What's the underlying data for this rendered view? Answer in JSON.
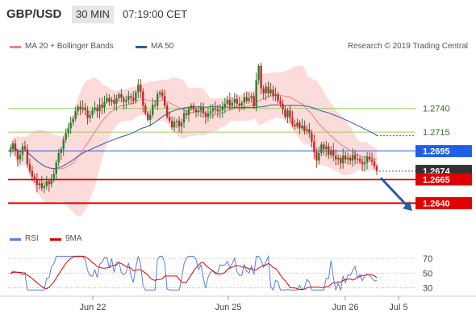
{
  "header": {
    "symbol": "GBP/USD",
    "timeframe": "30 MIN",
    "time": "07:19:00 CET"
  },
  "credit": "Research © 2019 Trading Central",
  "legend": {
    "items": [
      {
        "label": "MA 20 + Bollinger Bands",
        "color": "#f08080"
      },
      {
        "label": "MA 50",
        "color": "#2e5aa8"
      }
    ]
  },
  "rsi_legend": {
    "items": [
      {
        "label": "RSI",
        "color": "#5b7fe0"
      },
      {
        "label": "9MA",
        "color": "#e00000"
      }
    ]
  },
  "colors": {
    "up_candle": "#2e7d32",
    "down_candle": "#c62828",
    "bollinger_fill": "#fbd5d5",
    "ma20": "#f08080",
    "ma50": "#2e5aa8",
    "support": "#e00000",
    "pivot": "#1f5ee8",
    "resistance": "#9ccc65",
    "last_price_tag": "#333333",
    "rsi": "#5b7fe0",
    "rsi_ma": "#e00000"
  },
  "chart_data": [
    {
      "type": "candlestick",
      "title": "GBP/USD",
      "ylim": [
        1.2625,
        1.2795
      ],
      "x_tick_labels": [
        "Jun 22",
        "Jun 25",
        "Jun 26",
        "Jul 5"
      ],
      "y_tick_labels": [
        "1.2740",
        "1.2715",
        "1.2695",
        "1.2674",
        "1.2665",
        "1.2640"
      ],
      "levels": [
        {
          "name": "resistance-2",
          "value": 1.274,
          "label": "1.2740",
          "kind": "resistance"
        },
        {
          "name": "resistance-1",
          "value": 1.2715,
          "label": "1.2715",
          "kind": "resistance"
        },
        {
          "name": "pivot",
          "value": 1.2695,
          "label": "1.2695",
          "kind": "pivot"
        },
        {
          "name": "last-price",
          "value": 1.2674,
          "label": "1.2674",
          "kind": "last"
        },
        {
          "name": "support-1",
          "value": 1.2665,
          "label": "1.2665",
          "kind": "support"
        },
        {
          "name": "support-2",
          "value": 1.264,
          "label": "1.2640",
          "kind": "support"
        }
      ],
      "close": [
        1.2697,
        1.2703,
        1.2695,
        1.2686,
        1.2691,
        1.27,
        1.2697,
        1.2681,
        1.2674,
        1.2668,
        1.2664,
        1.2659,
        1.2661,
        1.2656,
        1.2658,
        1.2663,
        1.266,
        1.2666,
        1.2671,
        1.2683,
        1.2693,
        1.2697,
        1.2707,
        1.2714,
        1.2719,
        1.2725,
        1.2729,
        1.2737,
        1.2742,
        1.2739,
        1.2741,
        1.2738,
        1.273,
        1.2733,
        1.2738,
        1.2741,
        1.2737,
        1.2744,
        1.2741,
        1.2747,
        1.2751,
        1.2747,
        1.2749,
        1.2745,
        1.2751,
        1.2755,
        1.2751,
        1.2747,
        1.2749,
        1.2753,
        1.2751,
        1.2748,
        1.2757,
        1.2765,
        1.2758,
        1.2743,
        1.2735,
        1.2728,
        1.2733,
        1.2744,
        1.2743,
        1.2755,
        1.2757,
        1.2753,
        1.2743,
        1.2731,
        1.2727,
        1.272,
        1.2726,
        1.2727,
        1.2721,
        1.2725,
        1.2735,
        1.2733,
        1.274,
        1.2743,
        1.2739,
        1.2736,
        1.2738,
        1.2741,
        1.2735,
        1.2731,
        1.2735,
        1.2737,
        1.274,
        1.2739,
        1.2737,
        1.2738,
        1.2742,
        1.2745,
        1.2749,
        1.2743,
        1.2746,
        1.275,
        1.2745,
        1.2743,
        1.2746,
        1.2752,
        1.2748,
        1.2751,
        1.2753,
        1.2742,
        1.277,
        1.2785,
        1.2761,
        1.2756,
        1.2763,
        1.2756,
        1.276,
        1.2753,
        1.2755,
        1.2748,
        1.2745,
        1.2739,
        1.2731,
        1.2738,
        1.273,
        1.2723,
        1.2721,
        1.2725,
        1.2719,
        1.2722,
        1.2716,
        1.2718,
        1.2714,
        1.2705,
        1.2694,
        1.2685,
        1.2693,
        1.2702,
        1.2697,
        1.27,
        1.2691,
        1.2696,
        1.269,
        1.2686,
        1.2688,
        1.2682,
        1.269,
        1.2686,
        1.2688,
        1.2685,
        1.2691,
        1.2686,
        1.2687,
        1.2684,
        1.2681,
        1.2683,
        1.2689,
        1.2686,
        1.2684,
        1.2679,
        1.2674
      ],
      "ma20_visible": true,
      "ma50_visible": true,
      "bollinger_visible": true
    },
    {
      "type": "line",
      "title": "RSI",
      "ylim": [
        25,
        80
      ],
      "y_tick_labels": [
        "70",
        "50",
        "30"
      ],
      "y_ticks": [
        70,
        50,
        30
      ],
      "series": [
        {
          "name": "RSI"
        },
        {
          "name": "9MA"
        }
      ]
    }
  ]
}
